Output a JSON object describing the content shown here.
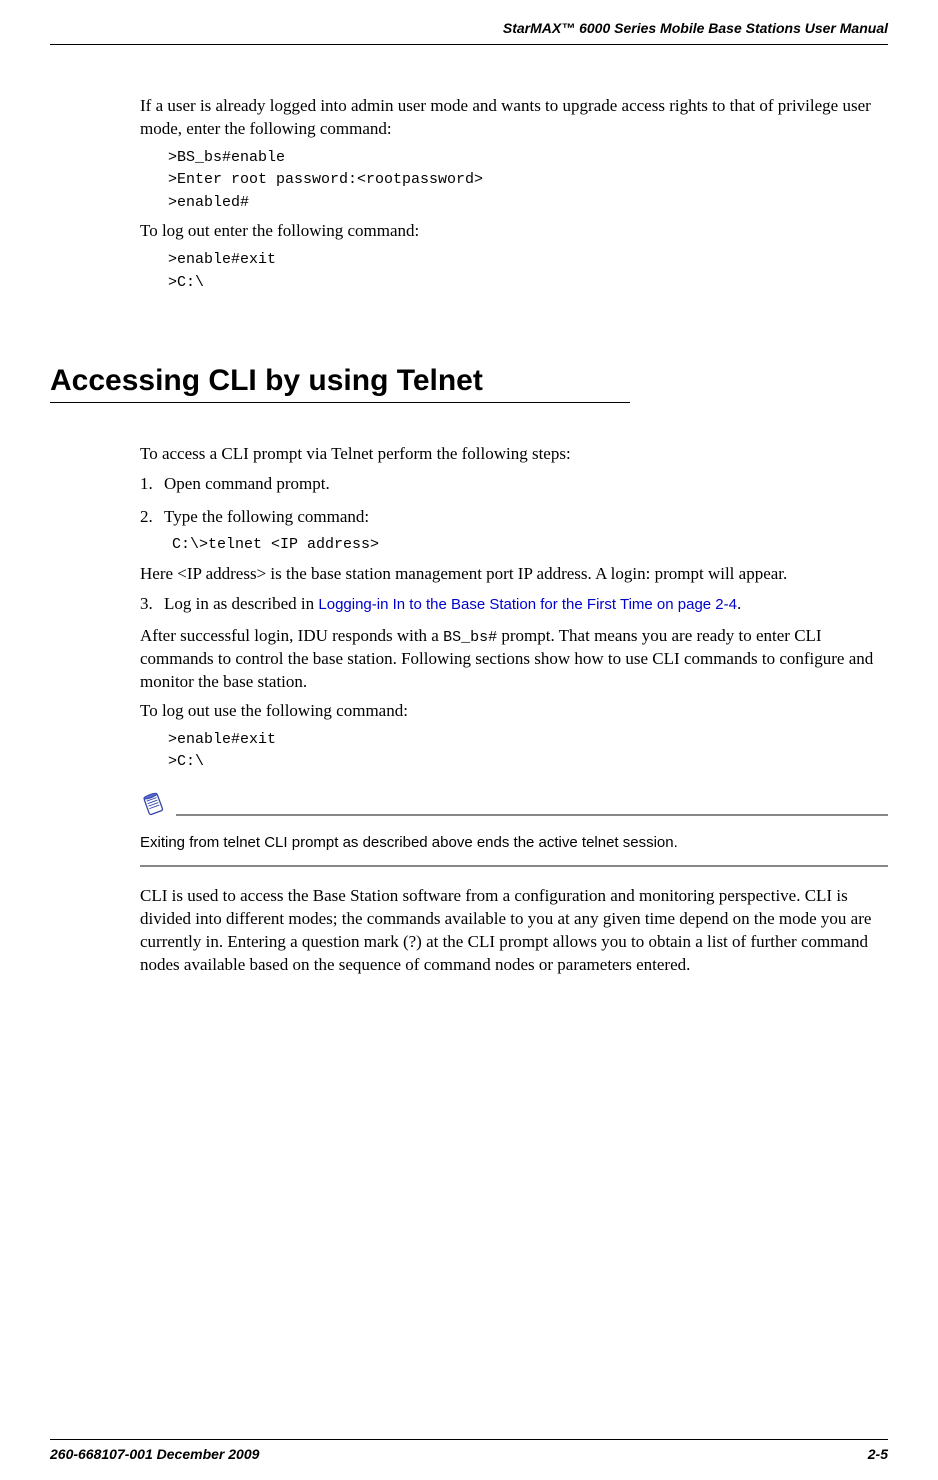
{
  "header": {
    "title": "StarMAX™ 6000 Series Mobile Base Stations User Manual"
  },
  "intro": {
    "p1": "If a user is already logged into admin user mode and wants to upgrade access rights to that of privilege user mode, enter the following command:",
    "code1_l1": ">BS_bs#enable",
    "code1_l2": ">Enter root password:<rootpassword>",
    "code1_l3": ">enabled#",
    "p2": "To log out enter the following command:",
    "code2_l1": ">enable#exit",
    "code2_l2": ">C:\\"
  },
  "section": {
    "heading": "Accessing CLI by using Telnet",
    "p1": "To access a CLI prompt via Telnet perform the following steps:",
    "steps": {
      "s1_num": "1.",
      "s1_text": "Open command prompt.",
      "s2_num": "2.",
      "s2_text": "Type the following command:",
      "s2_code": "C:\\>telnet <IP address>",
      "s3_num": "3.",
      "s3_text_a": "Log in as described in ",
      "s3_link": "Logging-in In to the Base Station for the First Time on page 2-4",
      "s3_text_b": "."
    },
    "p2": "Here <IP address> is the base station management port IP address. A login: prompt will appear.",
    "p3_a": "After successful login, IDU responds with a ",
    "p3_code": "BS_bs#",
    "p3_b": " prompt. That means you are ready to enter CLI commands to control the base station. Following sections show how to use CLI commands to configure and monitor the base station.",
    "p4": "To log out use the following command:",
    "code3_l1": ">enable#exit",
    "code3_l2": ">C:\\",
    "note": "Exiting from telnet CLI prompt as described above ends the active telnet session.",
    "p5": "CLI is used to access the Base Station software from a configuration and monitoring perspective. CLI is divided into different modes; the commands available to you at any given time depend on the mode you are currently in. Entering a question mark (?) at the CLI prompt allows you to obtain a list of further command nodes available based on the sequence of command nodes or parameters entered."
  },
  "footer": {
    "left": "260-668107-001 December 2009",
    "right": "2-5"
  }
}
